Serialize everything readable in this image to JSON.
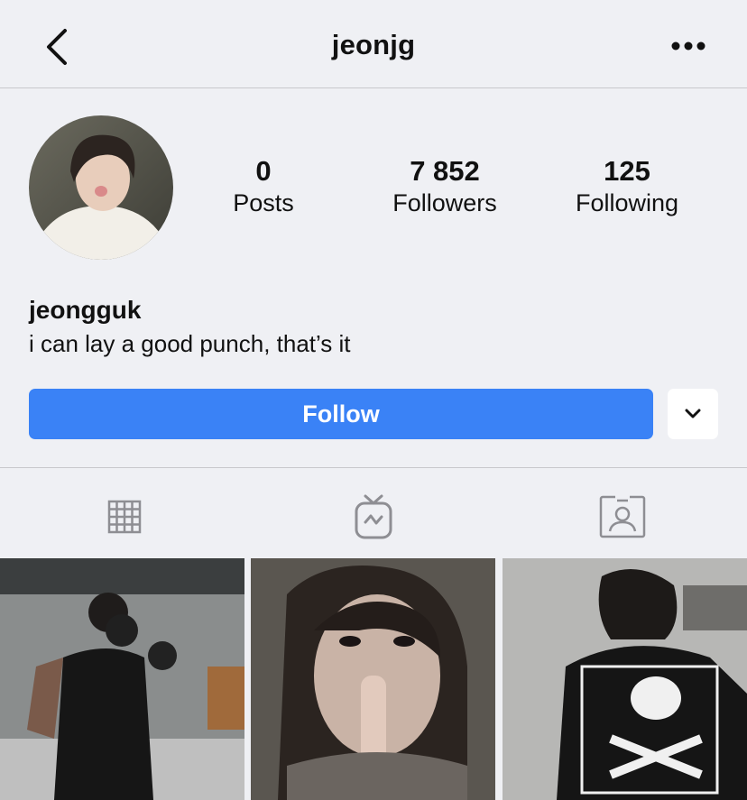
{
  "header": {
    "username": "jeonjg"
  },
  "profile": {
    "stats": [
      {
        "value": "0",
        "label": "Posts"
      },
      {
        "value": "7 852",
        "label": "Followers"
      },
      {
        "value": "125",
        "label": "Following"
      }
    ],
    "name": "jeongguk",
    "bio": "i can lay a good punch, that’s it"
  },
  "actions": {
    "follow_label": "Follow"
  },
  "tabs": [
    {
      "icon": "grid-icon"
    },
    {
      "icon": "igtv-icon"
    },
    {
      "icon": "tagged-icon"
    }
  ],
  "posts": [
    {
      "description": "photo"
    },
    {
      "description": "photo"
    },
    {
      "description": "photo"
    }
  ],
  "colors": {
    "accent": "#3a82f6",
    "background": "#eff0f4",
    "icon_gray": "#8e8e93"
  }
}
